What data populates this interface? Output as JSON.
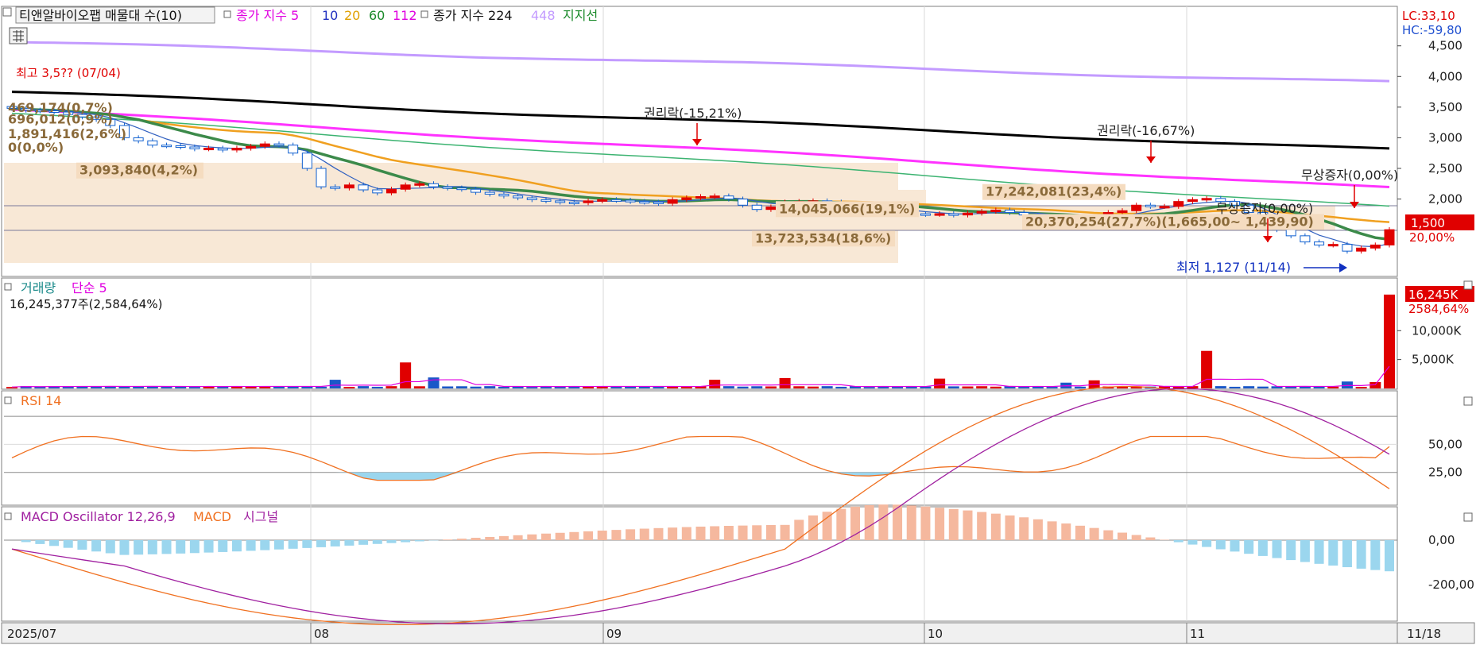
{
  "legend": {
    "main": {
      "title": "티앤알바이오팹 매물대 수(10)",
      "series_label": "종가 지수 5",
      "ma10": "10",
      "ma20": "20",
      "ma60": "60",
      "ma112": "112",
      "series_label2": "종가 지수 224",
      "ma448": "448",
      "support": "지지선"
    },
    "volume": {
      "title": "거래량",
      "ma": "단순 5",
      "value": "16,245,377주(2,584,64%)"
    },
    "rsi": {
      "title": "RSI 14"
    },
    "macd": {
      "title": "MACD Oscillator 12,26,9",
      "macd": "MACD",
      "signal": "시그널"
    }
  },
  "right_axis": {
    "main": {
      "lc": "LC:33,10",
      "hc": "HC:-59,80",
      "ticks": [
        "4,500",
        "4,000",
        "3,500",
        "3,000",
        "2,500",
        "2,000",
        "1,500"
      ],
      "current_price": "1,500",
      "current_pct": "20,00%"
    },
    "volume": {
      "ticks": [
        "10,000K",
        "5,000K"
      ],
      "current": "16,245K",
      "current_pct": "2584,64%"
    },
    "rsi": {
      "ticks": [
        "50,00",
        "25,00"
      ]
    },
    "macd": {
      "ticks": [
        "0,00",
        "-200,00"
      ]
    }
  },
  "x_axis": {
    "labels": [
      "2025/07",
      "08",
      "09",
      "10",
      "11",
      "11/18"
    ]
  },
  "annotations": {
    "high": "최고 3,5?? (07/04)",
    "low": "최저 1,127 (11/14)",
    "ex_rights1": "권리락(-15,21%)",
    "ex_rights2": "권리락(-16,67%)",
    "bonus_issue1": "무상증자(0,00%)",
    "bonus_issue2": "무상증자(0,00%)"
  },
  "volume_profile": [
    {
      "label": "469,174(0,7%)",
      "price": 3420
    },
    {
      "label": "696,012(0,9%)",
      "price": 3230
    },
    {
      "label": "1,891,416(2,6%)",
      "price": 2990
    },
    {
      "label": "0(0,0%)",
      "price": 2770
    },
    {
      "label": "3,093,840(4,2%)",
      "price": 2400
    },
    {
      "label": "17,242,081(23,4%)",
      "price": 2050
    },
    {
      "label": "14,045,066(19,1%)",
      "price": 1770
    },
    {
      "label": "20,370,254(27,7%)(1,665,00~ 1,439,90)",
      "price": 1560
    },
    {
      "label": "13,723,534(18,6%)",
      "price": 1290
    }
  ],
  "chart_data": {
    "type": "candlestick",
    "x_start": "2025-07-01",
    "x_end": "2025-11-18",
    "price_range": [
      1100,
      4600
    ],
    "close_series": [
      3480,
      3450,
      3440,
      3420,
      3380,
      3340,
      3300,
      3200,
      3000,
      2950,
      2880,
      2870,
      2850,
      2820,
      2830,
      2800,
      2830,
      2860,
      2900,
      2880,
      2750,
      2500,
      2200,
      2180,
      2230,
      2150,
      2100,
      2160,
      2230,
      2250,
      2200,
      2180,
      2160,
      2110,
      2080,
      2050,
      2020,
      1990,
      1970,
      1950,
      1940,
      1970,
      1990,
      1980,
      1960,
      1950,
      1930,
      1990,
      2020,
      2040,
      2050,
      2000,
      1900,
      1830,
      1870,
      1950,
      1960,
      1970,
      1950,
      1920,
      1880,
      1850,
      1820,
      1790,
      1760,
      1750,
      1760,
      1740,
      1770,
      1800,
      1820,
      1780,
      1740,
      1700,
      1680,
      1660,
      1640,
      1660,
      1780,
      1810,
      1900,
      1880,
      1880,
      1960,
      1990,
      2010,
      1960,
      1900,
      1780,
      1600,
      1500,
      1400,
      1300,
      1250,
      1260,
      1150,
      1200,
      1250,
      1500
    ],
    "volume_ticks": [
      5000,
      10000
    ],
    "rsi_levels": [
      25,
      50,
      75
    ],
    "macd_levels": [
      0,
      -200
    ]
  }
}
